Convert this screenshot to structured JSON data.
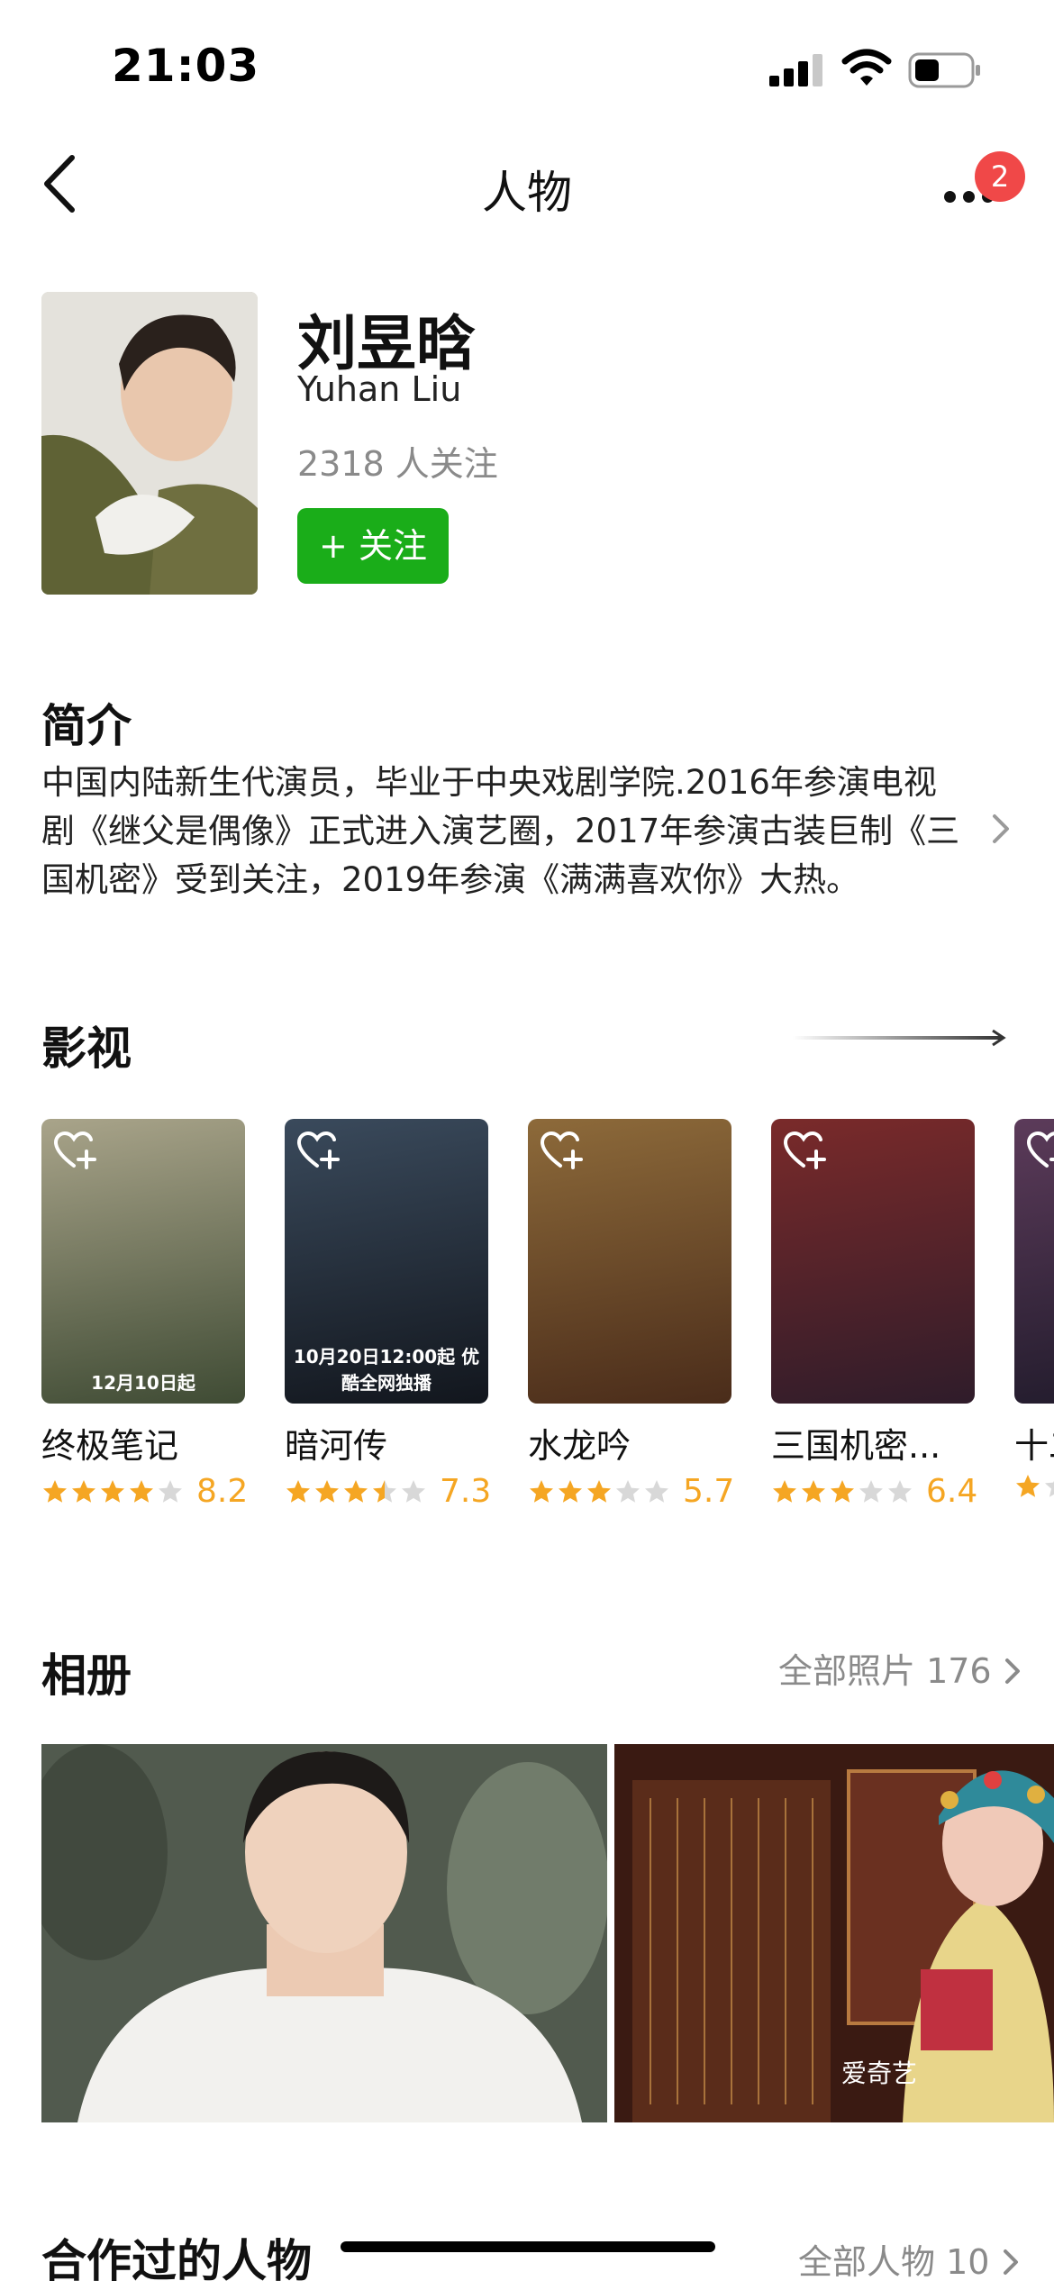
{
  "status_bar": {
    "time": "21:03"
  },
  "nav": {
    "title": "人物",
    "badge_count": "2"
  },
  "profile": {
    "name_cn": "刘昱晗",
    "name_en": "Yuhan Liu",
    "followers": "2318 人关注",
    "follow_label": "+ 关注"
  },
  "intro": {
    "title": "简介",
    "text": "中国内陆新生代演员，毕业于中央戏剧学院.2016年参演电视剧《继父是偶像》正式进入演艺圈，2017年参演古装巨制《三国机密》受到关注，2019年参演《满满喜欢你》大热。"
  },
  "films": {
    "title": "影视",
    "items": [
      {
        "title": "终极笔记",
        "score": "8.2",
        "stars": 4,
        "poster_text": "12月10日起",
        "colors": [
          "#a9a48a",
          "#3f4b34"
        ]
      },
      {
        "title": "暗河传",
        "score": "7.3",
        "stars": 3.5,
        "poster_text": "10月20日12:00起 优酷全网独播",
        "colors": [
          "#3a4a5c",
          "#12161d"
        ]
      },
      {
        "title": "水龙吟",
        "score": "5.7",
        "stars": 3,
        "poster_text": "",
        "colors": [
          "#8d6a3a",
          "#4a2c1a"
        ]
      },
      {
        "title": "三国机密...",
        "score": "6.4",
        "stars": 3,
        "poster_text": "",
        "colors": [
          "#7a2a2a",
          "#2f1c2a"
        ]
      },
      {
        "title": "十二",
        "score": "",
        "stars": 1,
        "poster_text": "",
        "colors": [
          "#5c3b5a",
          "#1f1a2a"
        ]
      }
    ]
  },
  "album": {
    "title": "相册",
    "see_all": "全部照片 176",
    "watermark": "爱奇艺"
  },
  "collaborators": {
    "title": "合作过的人物",
    "see_all": "全部人物 10"
  },
  "colors": {
    "accent_green": "#1aad19",
    "star_orange": "#f5a623",
    "badge_red": "#f04848"
  }
}
